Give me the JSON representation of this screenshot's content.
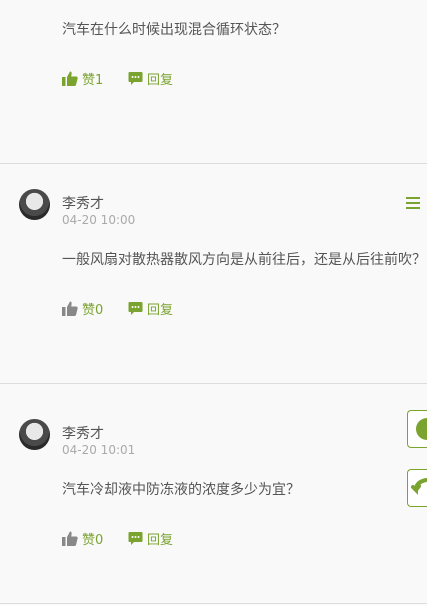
{
  "comments": [
    {
      "question": "汽车在什么时候出现混合循环状态？",
      "like_label": "赞1",
      "reply_label": "回复"
    },
    {
      "author": "李秀才",
      "time": "04-20 10:00",
      "question": "一般风扇对散热器散风方向是从前往后，还是从后往前吹？",
      "like_label": "赞0",
      "reply_label": "回复"
    },
    {
      "author": "李秀才",
      "time": "04-20 10:01",
      "question": "汽车冷却液中防冻液的浓度多少为宜？",
      "like_label": "赞0",
      "reply_label": "回复"
    }
  ],
  "icons": {
    "like": "thumbs-up-icon",
    "reply": "comment-bubble-icon",
    "menu": "hamburger-menu-icon",
    "avatar": "user-avatar"
  },
  "colors": {
    "accent": "#7aa330",
    "gray_icon": "#888888",
    "divider": "#dddddd",
    "background": "#f9f9f9"
  }
}
